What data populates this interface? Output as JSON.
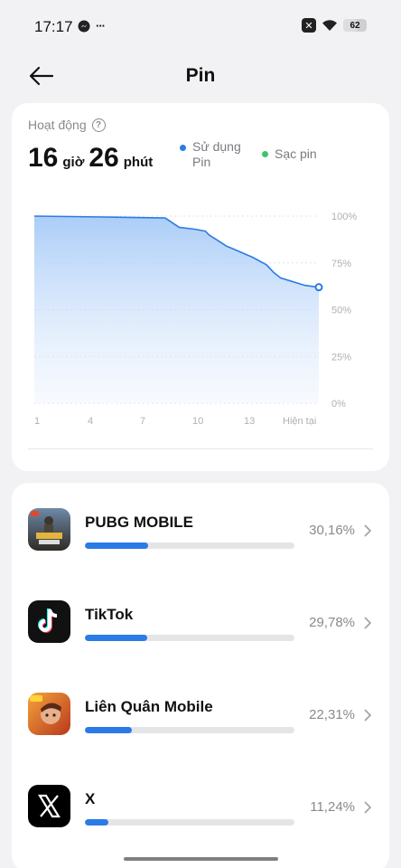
{
  "status": {
    "time": "17:17",
    "more": "···",
    "x_box": "✕",
    "battery": "62"
  },
  "header": {
    "title": "Pin"
  },
  "activity": {
    "label": "Hoạt động",
    "hours": "16",
    "hours_unit": "giờ",
    "minutes": "26",
    "minutes_unit": "phút",
    "legend_usage_line1": "Sử dụng",
    "legend_usage_line2": "Pin",
    "legend_charge": "Sạc pin",
    "colors": {
      "usage": "#2b7be6",
      "charge": "#3cc56b"
    }
  },
  "chart_data": {
    "type": "area",
    "x_tick_labels": [
      "1",
      "4",
      "7",
      "10",
      "13",
      "Hiện tại"
    ],
    "y_tick_labels": [
      "100%",
      "75%",
      "50%",
      "25%",
      "0%"
    ],
    "ylim": [
      0,
      100
    ],
    "x": [
      1,
      5,
      8.5,
      9.3,
      10.2,
      10.8,
      11,
      12,
      13.5,
      14.3,
      14.7,
      15.1,
      16.5,
      17.3
    ],
    "values": [
      100,
      99.5,
      99,
      94,
      93,
      92,
      90,
      84,
      78,
      74,
      70,
      67,
      63,
      62
    ],
    "grid": true,
    "legend": "top-right",
    "series": [
      {
        "name": "Sử dụng Pin",
        "color": "#2b7be6"
      }
    ]
  },
  "apps": [
    {
      "name": "PUBG MOBILE",
      "percent_text": "30,16%",
      "percent": 30.16,
      "icon": "pubg-mobile-app-icon"
    },
    {
      "name": "TikTok",
      "percent_text": "29,78%",
      "percent": 29.78,
      "icon": "tiktok-app-icon"
    },
    {
      "name": "Liên Quân Mobile",
      "percent_text": "22,31%",
      "percent": 22.31,
      "icon": "lien-quan-mobile-app-icon"
    },
    {
      "name": "X",
      "percent_text": "11,24%",
      "percent": 11.24,
      "icon": "x-app-icon"
    }
  ]
}
